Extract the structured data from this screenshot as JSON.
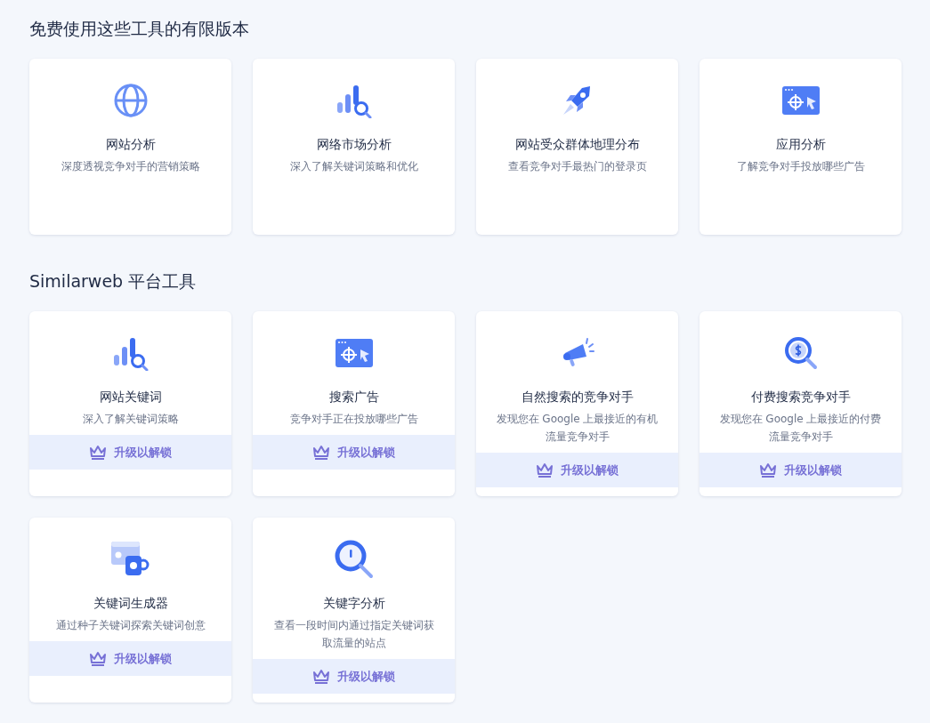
{
  "sections": [
    {
      "title": "免费使用这些工具的有限版本",
      "cards": [
        {
          "kind": "globe",
          "title": "网站分析",
          "description": "深度透视竞争对手的营销策略"
        },
        {
          "kind": "bars-search",
          "title": "网络市场分析",
          "description": "深入了解关键词策略和优化"
        },
        {
          "kind": "rocket",
          "title": "网站受众群体地理分布",
          "description": "查看竞争对手最热门的登录页"
        },
        {
          "kind": "browser-target",
          "title": "应用分析",
          "description": "了解竞争对手投放哪些广告"
        }
      ]
    },
    {
      "title": "Similarweb 平台工具",
      "cards": [
        {
          "kind": "bars-search",
          "title": "网站关键词",
          "description": "深入了解关键词策略",
          "upgrade": "升级以解锁"
        },
        {
          "kind": "browser-target",
          "title": "搜索广告",
          "description": "竞争对手正在投放哪些广告",
          "upgrade": "升级以解锁"
        },
        {
          "kind": "megaphone",
          "title": "自然搜索的竞争对手",
          "description": "发现您在 Google 上最接近的有机流量竞争对手",
          "upgrade": "升级以解锁"
        },
        {
          "kind": "dollar-search",
          "title": "付费搜索竞争对手",
          "description": "发现您在 Google 上最接近的付费流量竞争对手",
          "upgrade": "升级以解锁"
        },
        {
          "kind": "browser-mug",
          "title": "关键词生成器",
          "description": "通过种子关键词探索关键词创意",
          "upgrade": "升级以解锁"
        },
        {
          "kind": "search-alert",
          "title": "关键字分析",
          "description": "查看一段时间内通过指定关键词获取流量的站点",
          "upgrade": "升级以解锁"
        }
      ]
    }
  ]
}
